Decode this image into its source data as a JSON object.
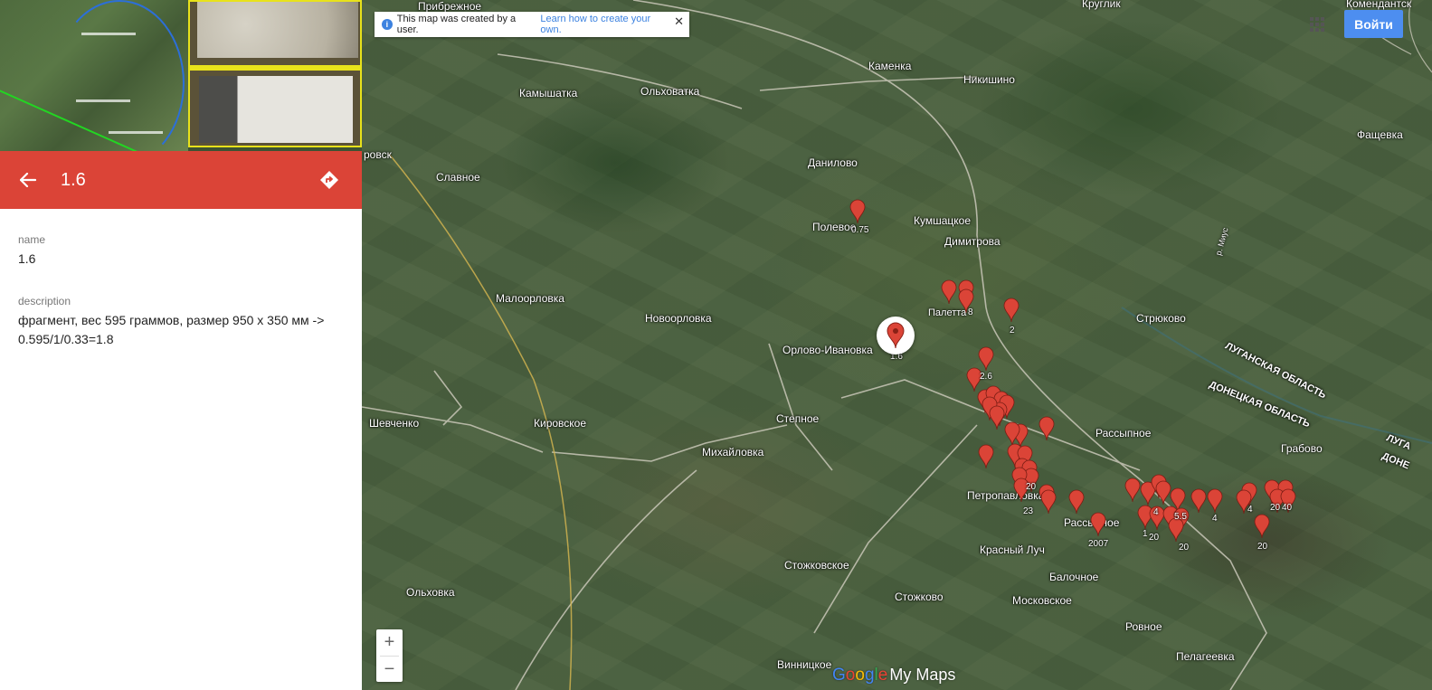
{
  "panel": {
    "title": "1.6",
    "fields": [
      {
        "label": "name",
        "value": "1.6"
      },
      {
        "label": "description",
        "value_line1": "фрагмент, вес 595 граммов, размер 950 х 350 мм ->",
        "value_line2": "0.595/1/0.33=1.8"
      }
    ]
  },
  "map": {
    "notice": {
      "text": "This map was created by a user.",
      "link": "Learn how to create your own."
    },
    "signin_label": "Войти",
    "zoom_in": "+",
    "zoom_out": "−",
    "logo": {
      "google": "Google",
      "suffix": "My Maps"
    },
    "places": [
      "Прибрежное",
      "Круглик",
      "Комендантск",
      "Каменка",
      "Камышатка",
      "Ольховатка",
      "Никишино",
      "Фащевка",
      "Славное",
      "Данилово",
      "Полевое",
      "Кумшацкое",
      "Димитрова",
      "Малоорловка",
      "Новоорловка",
      "Орлово-Ивановка",
      "Стрюково",
      "Шевченко",
      "Кировское",
      "Степное",
      "Михайловка",
      "Рассыпное",
      "Грабово",
      "Петропавловка",
      "Рассыпное",
      "Красный Луч",
      "Балочное",
      "Стожковское",
      "Ольховка",
      "Стожково",
      "Московское",
      "Ровное",
      "Винницкое",
      "Пелагеевка",
      "ровск",
      "Палетта"
    ],
    "regions": [
      "ЛУГАНСКАЯ ОБЛАСТЬ",
      "ДОНЕЦКАЯ ОБЛАСТЬ",
      "ЛУГА",
      "ДОНЕ"
    ],
    "pin_labels": [
      "0.75",
      "8",
      "2",
      "1.6",
      "2.6",
      "20",
      "23",
      "2007",
      "1",
      "20",
      "4",
      "5.5",
      "4",
      "20",
      "4",
      "20",
      "40",
      "20"
    ],
    "road_label": "р. Миус",
    "colors": {
      "pin": "#db4437",
      "header": "#db4437",
      "signin": "#4d8ef0",
      "link": "#3c82e0"
    },
    "icons": [
      "back-arrow-icon",
      "directions-icon",
      "info-icon",
      "close-icon",
      "apps-grid-icon",
      "map-pin-icon"
    ]
  }
}
